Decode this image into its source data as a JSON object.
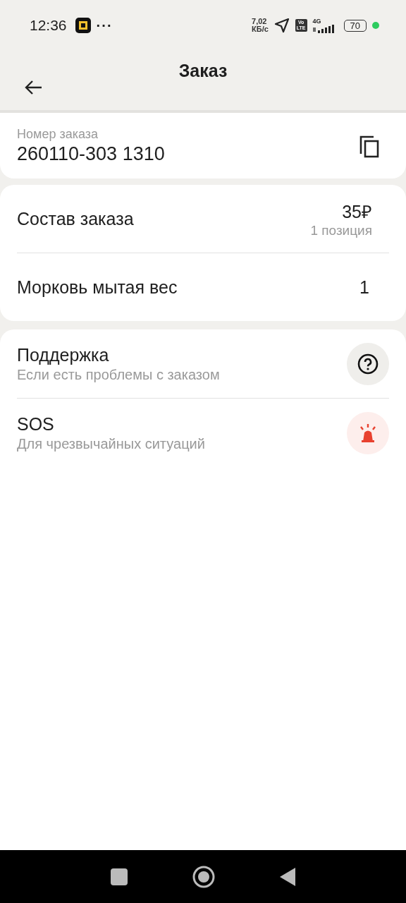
{
  "status_bar": {
    "time": "12:36",
    "more": "···",
    "speed_value": "7,02",
    "speed_unit": "КБ/с",
    "volte": [
      "Vo",
      "LTE"
    ],
    "network": "4G",
    "battery": "70"
  },
  "header": {
    "title": "Заказ"
  },
  "order_number": {
    "label": "Номер заказа",
    "value": "260110-303 1310"
  },
  "composition": {
    "title": "Состав заказа",
    "price": "35₽",
    "count": "1 позиция",
    "items": [
      {
        "name": "Морковь мытая вес",
        "quantity": "1"
      }
    ]
  },
  "actions": [
    {
      "kind": "help",
      "title": "Поддержка",
      "subtitle": "Если есть проблемы с заказом"
    },
    {
      "kind": "sos",
      "title": "SOS",
      "subtitle": "Для чрезвычайных ситуаций"
    }
  ]
}
